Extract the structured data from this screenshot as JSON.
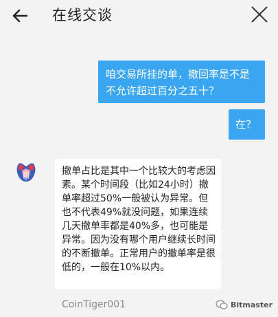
{
  "header": {
    "title": "在线交谈",
    "back_icon": "back-arrow-icon",
    "close_icon": "close-icon"
  },
  "messages": [
    {
      "direction": "outgoing",
      "text": "咱交易所挂的单，撤回率是不是不允许超过百分之五十？"
    },
    {
      "direction": "outgoing",
      "text": "在？"
    },
    {
      "direction": "incoming",
      "text": "撤单占比是其中一个比较大的考虑因素。某个时间段（比如24小时）撤单率超过50%一般被认为异常。但也不代表49%就没问题，如果连续几天撤单率都是40%多，也可能是异常。因为没有哪个用户继续长时间的不断撤单。正常用户的撤单率是很低的，一般在10%以内。",
      "sender": "CoinTiger001"
    }
  ],
  "watermark": {
    "text": "Bitmaster"
  },
  "colors": {
    "outgoing_bubble": "#3aa6f2",
    "incoming_bubble": "#ffffff",
    "background": "#f3f3f3"
  }
}
